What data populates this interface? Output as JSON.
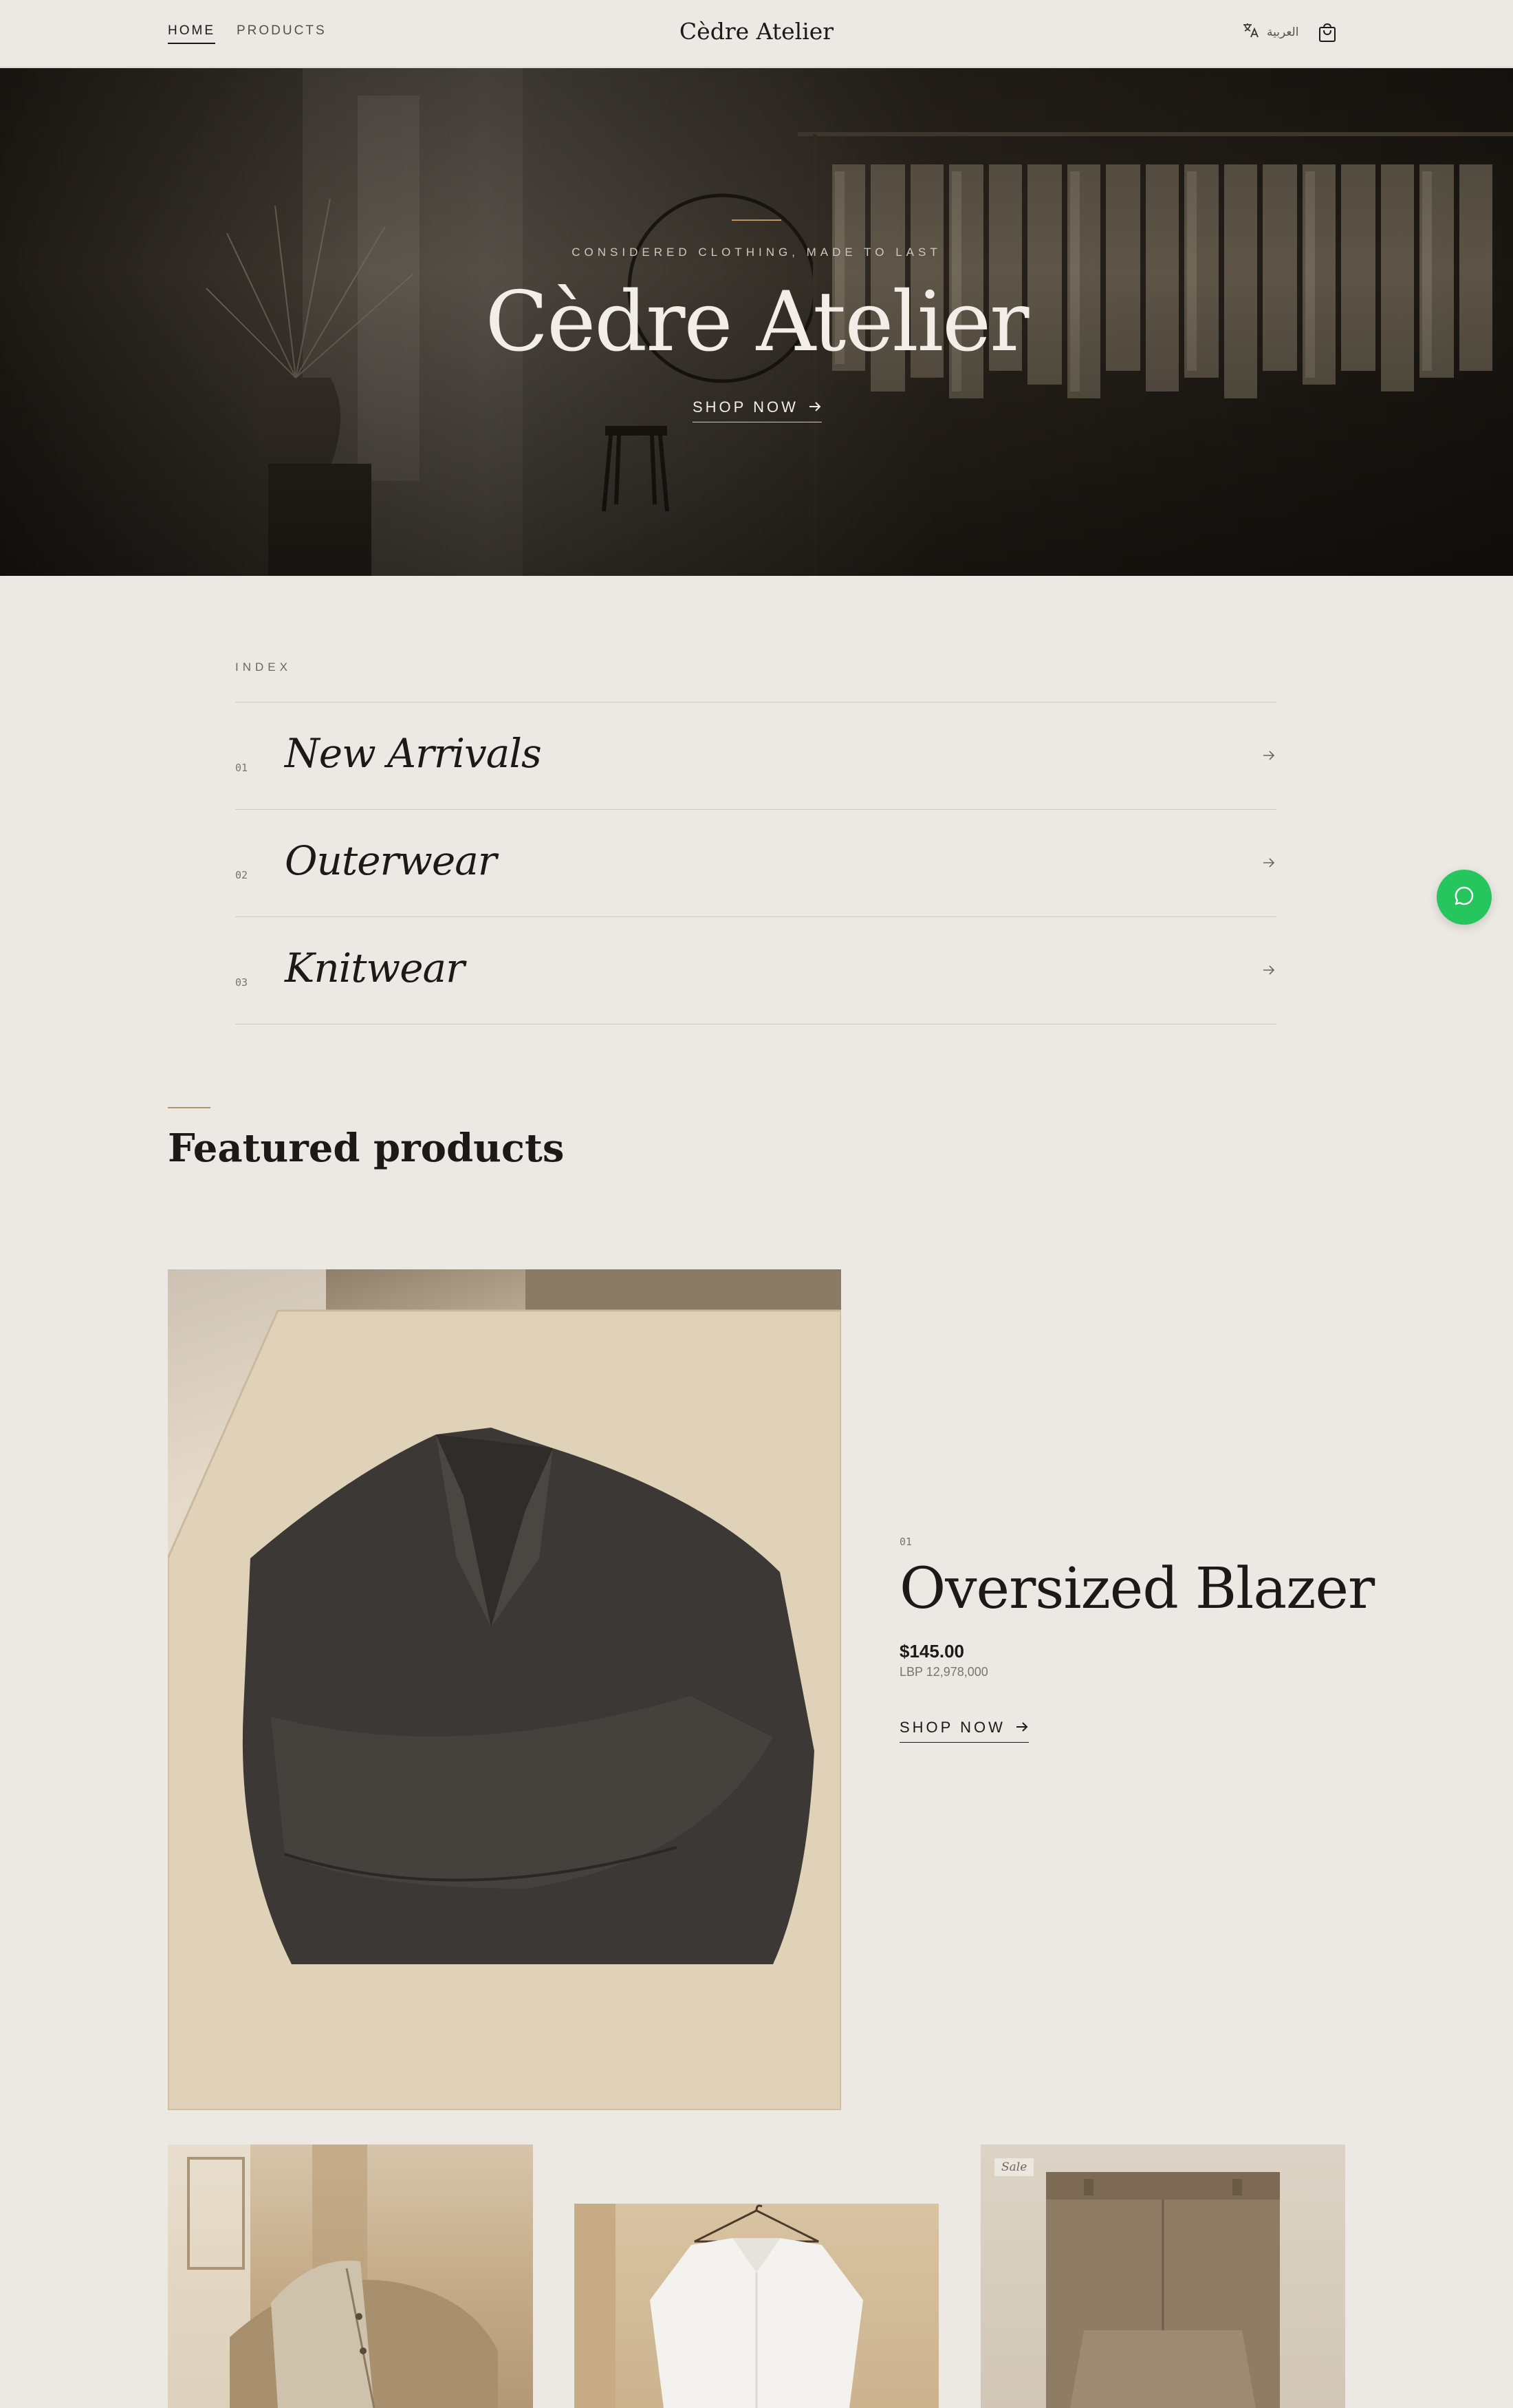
{
  "header": {
    "nav": [
      {
        "label": "HOME",
        "active": true
      },
      {
        "label": "PRODUCTS",
        "active": false
      }
    ],
    "brand": "Cèdre Atelier",
    "language_label": "العربية",
    "icons": {
      "language": "translate-icon",
      "cart": "shopping-bag-icon"
    }
  },
  "hero": {
    "kicker": "CONSIDERED CLOTHING, MADE TO LAST",
    "title": "Cèdre Atelier",
    "cta": "SHOP NOW"
  },
  "index": {
    "label": "INDEX",
    "items": [
      {
        "num": "01",
        "name": "New Arrivals"
      },
      {
        "num": "02",
        "name": "Outerwear"
      },
      {
        "num": "03",
        "name": "Knitwear"
      }
    ]
  },
  "featured": {
    "title": "Featured products",
    "product": {
      "index": "01",
      "name": "Oversized Blazer",
      "price": "$145.00",
      "price_lbp": "LBP 12,978,000",
      "cta": "SHOP NOW"
    },
    "tiles": [
      {
        "badge": ""
      },
      {
        "badge": ""
      },
      {
        "badge": "Sale"
      }
    ]
  },
  "colors": {
    "background": "#ece8e3",
    "accent": "#b89366",
    "chat": "#26c55e",
    "text": "#1c1a17"
  }
}
